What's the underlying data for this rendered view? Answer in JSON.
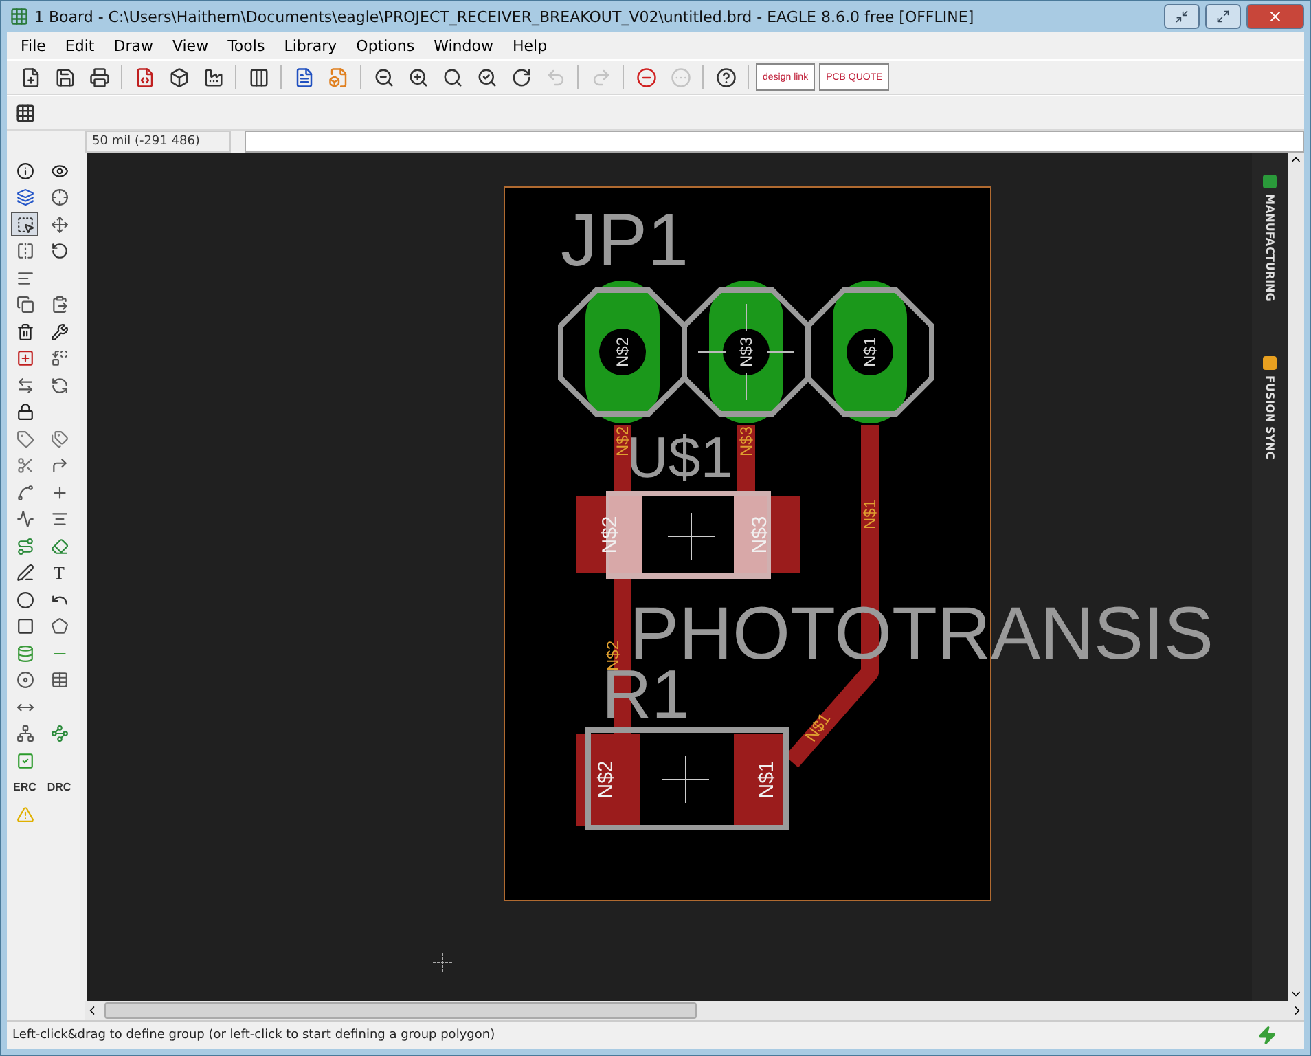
{
  "window": {
    "title": "1 Board - C:\\Users\\Haithem\\Documents\\eagle\\PROJECT_RECEIVER_BREAKOUT_V02\\untitled.brd - EAGLE 8.6.0 free [OFFLINE]"
  },
  "menu": [
    "File",
    "Edit",
    "Draw",
    "View",
    "Tools",
    "Library",
    "Options",
    "Window",
    "Help"
  ],
  "toolbar": [
    {
      "kind": "icon",
      "disabled": false
    },
    {
      "kind": "icon",
      "disabled": false
    },
    {
      "kind": "icon",
      "disabled": false
    },
    {
      "kind": "icon",
      "disabled": false
    },
    {
      "kind": "icon",
      "disabled": false
    },
    {
      "kind": "icon",
      "disabled": false
    },
    {
      "kind": "icon",
      "disabled": false
    },
    {
      "kind": "icon",
      "disabled": false
    },
    {
      "kind": "icon",
      "disabled": false
    },
    {
      "kind": "icon",
      "disabled": false
    },
    {
      "kind": "icon",
      "disabled": false
    },
    {
      "kind": "icon",
      "disabled": false
    },
    {
      "kind": "icon",
      "disabled": false
    },
    {
      "kind": "icon",
      "disabled": false
    },
    {
      "kind": "icon",
      "disabled": true
    },
    {
      "kind": "icon",
      "disabled": true
    },
    {
      "kind": "icon",
      "disabled": false
    },
    {
      "kind": "icon",
      "disabled": true
    },
    {
      "kind": "icon",
      "disabled": false
    },
    {
      "kind": "text",
      "label": "design link"
    },
    {
      "kind": "text",
      "label": "PCB QUOTE"
    }
  ],
  "coordinates": "50 mil (-291 486)",
  "toolbox": [
    {
      "kind": "icon",
      "selected": false
    },
    {
      "kind": "icon",
      "selected": false
    },
    {
      "kind": "icon",
      "selected": false
    },
    {
      "kind": "icon",
      "selected": false
    },
    {
      "kind": "icon",
      "selected": true
    },
    {
      "kind": "icon",
      "selected": false
    },
    {
      "kind": "icon",
      "selected": false
    },
    {
      "kind": "icon",
      "selected": false
    },
    {
      "kind": "icon",
      "selected": false
    },
    {
      "kind": "icon",
      "selected": false
    },
    {
      "kind": "icon",
      "selected": false
    },
    {
      "kind": "icon",
      "selected": false
    },
    {
      "kind": "icon",
      "selected": false
    },
    {
      "kind": "icon",
      "selected": false
    },
    {
      "kind": "icon",
      "selected": false
    },
    {
      "kind": "icon",
      "selected": false
    },
    {
      "kind": "icon",
      "selected": false
    },
    {
      "kind": "icon",
      "selected": false
    },
    {
      "kind": "icon",
      "selected": false
    },
    {
      "kind": "icon",
      "selected": false
    },
    {
      "kind": "icon",
      "selected": false
    },
    {
      "kind": "icon",
      "selected": false
    },
    {
      "kind": "icon",
      "selected": false
    },
    {
      "kind": "icon",
      "selected": false
    },
    {
      "kind": "icon",
      "selected": false
    },
    {
      "kind": "icon",
      "selected": false
    },
    {
      "kind": "icon",
      "selected": false
    },
    {
      "kind": "icon",
      "selected": false
    },
    {
      "kind": "icon",
      "selected": false
    },
    {
      "kind": "text",
      "label": "T",
      "selected": false
    },
    {
      "kind": "icon",
      "selected": false
    },
    {
      "kind": "icon",
      "selected": false
    },
    {
      "kind": "icon",
      "selected": false
    },
    {
      "kind": "icon",
      "selected": false
    },
    {
      "kind": "icon",
      "selected": false
    },
    {
      "kind": "icon",
      "selected": false
    },
    {
      "kind": "icon",
      "selected": false
    },
    {
      "kind": "icon",
      "selected": false
    },
    {
      "kind": "icon",
      "selected": false
    },
    {
      "kind": "icon",
      "selected": false
    },
    {
      "kind": "icon",
      "selected": false
    },
    {
      "kind": "icon",
      "selected": false
    },
    {
      "kind": "text",
      "label": "ERC",
      "selected": false
    },
    {
      "kind": "text",
      "label": "DRC",
      "selected": false
    },
    {
      "kind": "icon",
      "selected": false
    }
  ],
  "board": {
    "parts": [
      {
        "kind": "header",
        "name": "JP1",
        "pads": [
          "N$2",
          "N$3",
          "N$1"
        ]
      },
      {
        "kind": "smd",
        "name": "U$1",
        "value": "PHOTOTRANSIS",
        "pads": [
          "N$2",
          "N$3"
        ]
      },
      {
        "kind": "resistor",
        "name": "R1",
        "pads": [
          "N$2",
          "N$1"
        ]
      }
    ],
    "traces": [
      "N$2",
      "N$3",
      "N$1",
      "N$2",
      "N$1"
    ]
  },
  "side_tabs": [
    "MANUFACTURING",
    "FUSION SYNC"
  ],
  "status_bar": "Left-click&drag to define group (or left-click to start defining a group polygon)"
}
